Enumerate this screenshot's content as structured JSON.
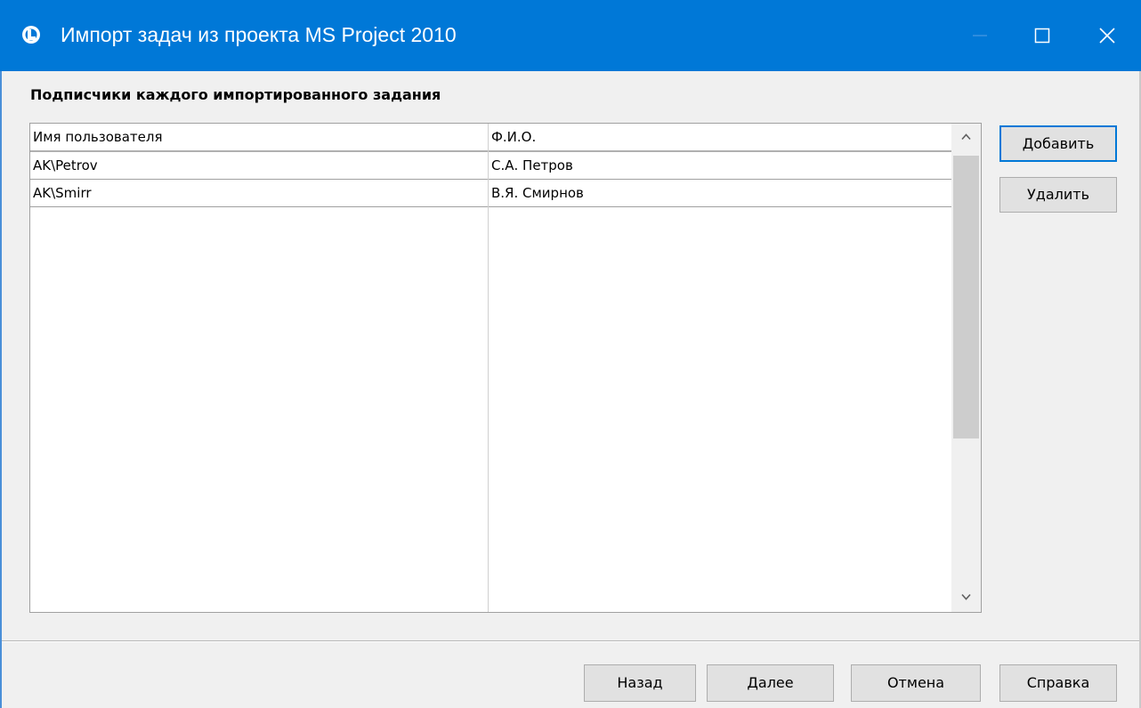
{
  "window": {
    "title": "Импорт задач из проекта MS Project 2010",
    "icon": "app-logo-icon",
    "controls": [
      "minimize-icon",
      "maximize-icon",
      "close-icon"
    ]
  },
  "section": {
    "title": "Подписчики каждого импортированного задания"
  },
  "table": {
    "columns": [
      "Имя пользователя",
      "Ф.И.О."
    ],
    "rows": [
      [
        "AK\\Petrov",
        "С.А. Петров"
      ],
      [
        "AK\\Smirr",
        "В.Я. Смирнов"
      ]
    ]
  },
  "side_buttons": {
    "add": "Добавить",
    "remove": "Удалить"
  },
  "footer_buttons": {
    "back": "Назад",
    "next": "Далее",
    "cancel": "Отмена",
    "help": "Справка"
  },
  "colors": {
    "titlebar": "#0078d7",
    "focus_border": "#0078d7"
  }
}
